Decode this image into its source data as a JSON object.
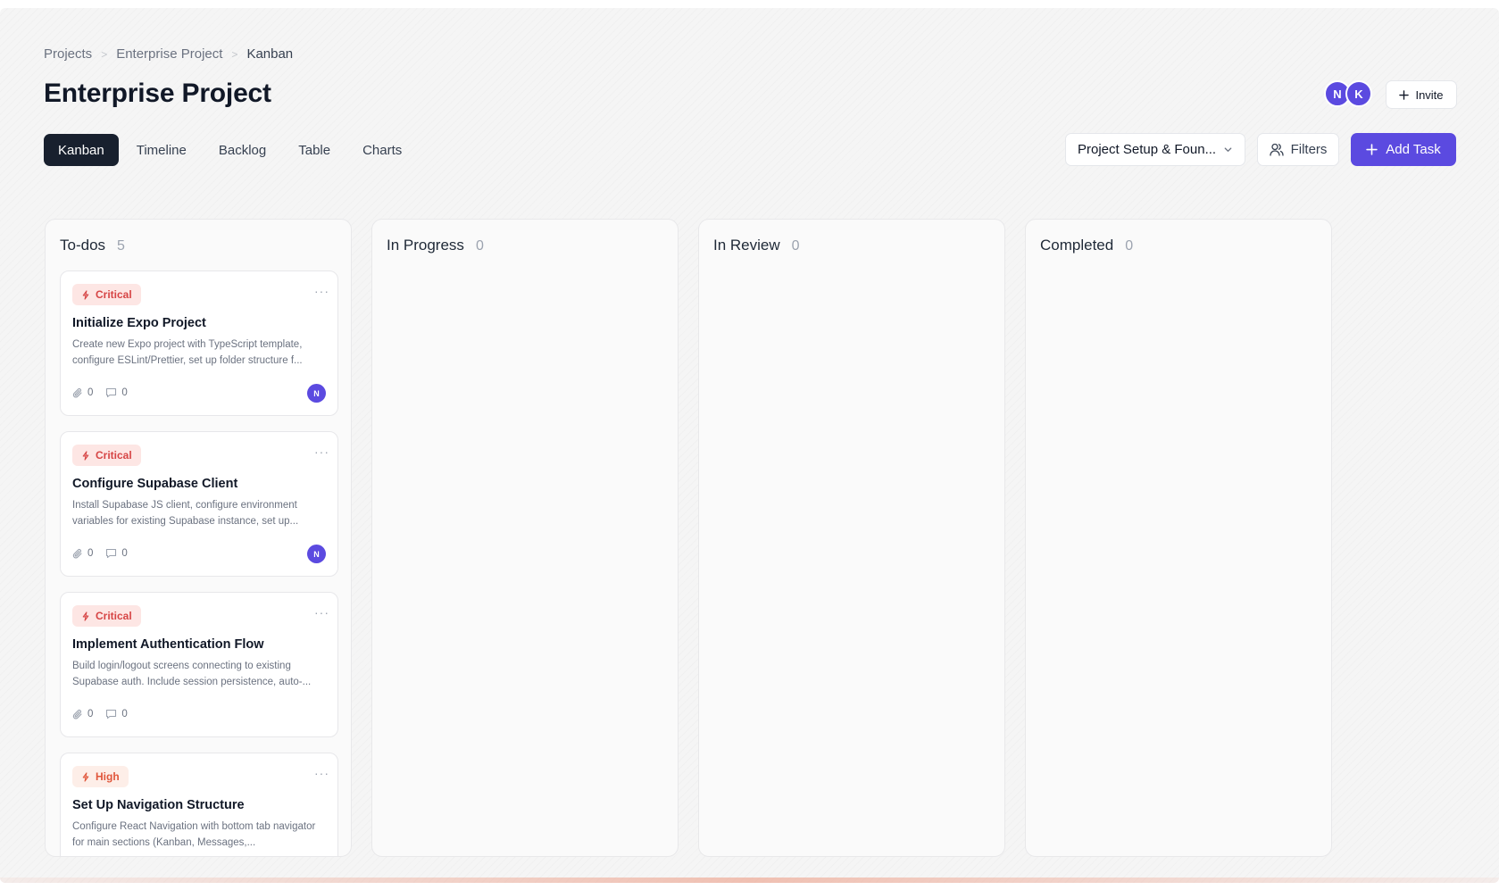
{
  "breadcrumb": {
    "items": [
      "Projects",
      "Enterprise Project",
      "Kanban"
    ],
    "separator": ">"
  },
  "page_title": "Enterprise Project",
  "members": [
    {
      "initial": "N"
    },
    {
      "initial": "K"
    }
  ],
  "invite_label": "Invite",
  "tabs": [
    {
      "label": "Kanban",
      "active": true
    },
    {
      "label": "Timeline",
      "active": false
    },
    {
      "label": "Backlog",
      "active": false
    },
    {
      "label": "Table",
      "active": false
    },
    {
      "label": "Charts",
      "active": false
    }
  ],
  "toolbar": {
    "milestone_select": "Project Setup & Foun...",
    "filters_label": "Filters",
    "add_task_label": "Add Task"
  },
  "columns": [
    {
      "title": "To-dos",
      "count": "5"
    },
    {
      "title": "In Progress",
      "count": "0"
    },
    {
      "title": "In Review",
      "count": "0"
    },
    {
      "title": "Completed",
      "count": "0"
    }
  ],
  "cards": [
    {
      "priority": "Critical",
      "title": "Initialize Expo Project",
      "description": "Create new Expo project with TypeScript template, configure ESLint/Prettier, set up folder structure f...",
      "attachments": "0",
      "comments": "0",
      "assignee": "N"
    },
    {
      "priority": "Critical",
      "title": "Configure Supabase Client",
      "description": "Install Supabase JS client, configure environment variables for existing Supabase instance, set up...",
      "attachments": "0",
      "comments": "0",
      "assignee": "N"
    },
    {
      "priority": "Critical",
      "title": "Implement Authentication Flow",
      "description": "Build login/logout screens connecting to existing Supabase auth. Include session persistence, auto-...",
      "attachments": "0",
      "comments": "0",
      "assignee": ""
    },
    {
      "priority": "High",
      "title": "Set Up Navigation Structure",
      "description": "Configure React Navigation with bottom tab navigator for main sections (Kanban, Messages,...",
      "attachments": "",
      "comments": "",
      "assignee": ""
    }
  ],
  "colors": {
    "accent": "#5b4ae0",
    "active_tab": "#18202e",
    "critical_bg": "#fde6e4",
    "critical_text": "#d64545",
    "high_bg": "#fdeee8",
    "high_text": "#e0563b"
  },
  "icons": {
    "invite": "plus-icon",
    "select": "chevron-down-icon",
    "filters": "users-icon",
    "add_task": "plus-icon",
    "priority": "bolt-icon",
    "attachments": "paperclip-icon",
    "comments": "comment-icon",
    "card_menu": "more-icon"
  }
}
